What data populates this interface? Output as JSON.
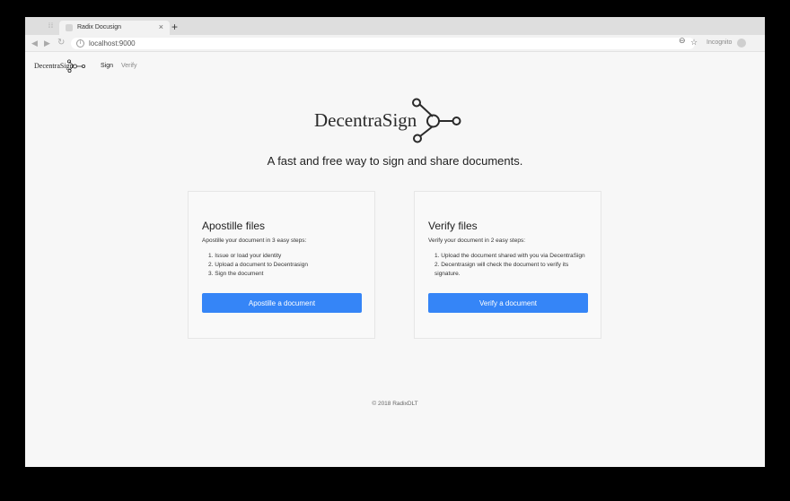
{
  "browser": {
    "tab_title": "Radix Docusign",
    "tab_close": "×",
    "new_tab": "+",
    "url": "localhost:9000",
    "profile_label": "Incognito",
    "icons": {
      "back": "arrow-left-icon",
      "forward": "arrow-right-icon",
      "reload": "reload-icon",
      "info": "info-icon",
      "zoom": "zoom-icon",
      "bookmark": "star-icon"
    }
  },
  "navbar": {
    "logo_text": "DecentraSign",
    "links": {
      "sign": "Sign",
      "verify": "Verify"
    }
  },
  "hero": {
    "logo_text": "DecentraSign",
    "tagline": "A fast and free way to sign and share documents."
  },
  "cards": {
    "apostille": {
      "title": "Apostille files",
      "description": "Apostille your document in 3 easy steps:",
      "steps": [
        "1. Issue or load your identity",
        "2. Upload a document to Decentrasign",
        "3. Sign the document"
      ],
      "button": "Apostille a document"
    },
    "verify": {
      "title": "Verify files",
      "description": "Verify your document in 2 easy steps:",
      "steps": [
        "1. Upload the document shared with you via DecentraSign",
        "2. Decentrasign will check the document to verify its signature."
      ],
      "button": "Verify a document"
    }
  },
  "footer": {
    "text": "© 2018 RadixDLT"
  },
  "colors": {
    "primary_button": "#3585f7",
    "page_bg": "#f7f7f7",
    "card_border": "#e6e6e6"
  }
}
